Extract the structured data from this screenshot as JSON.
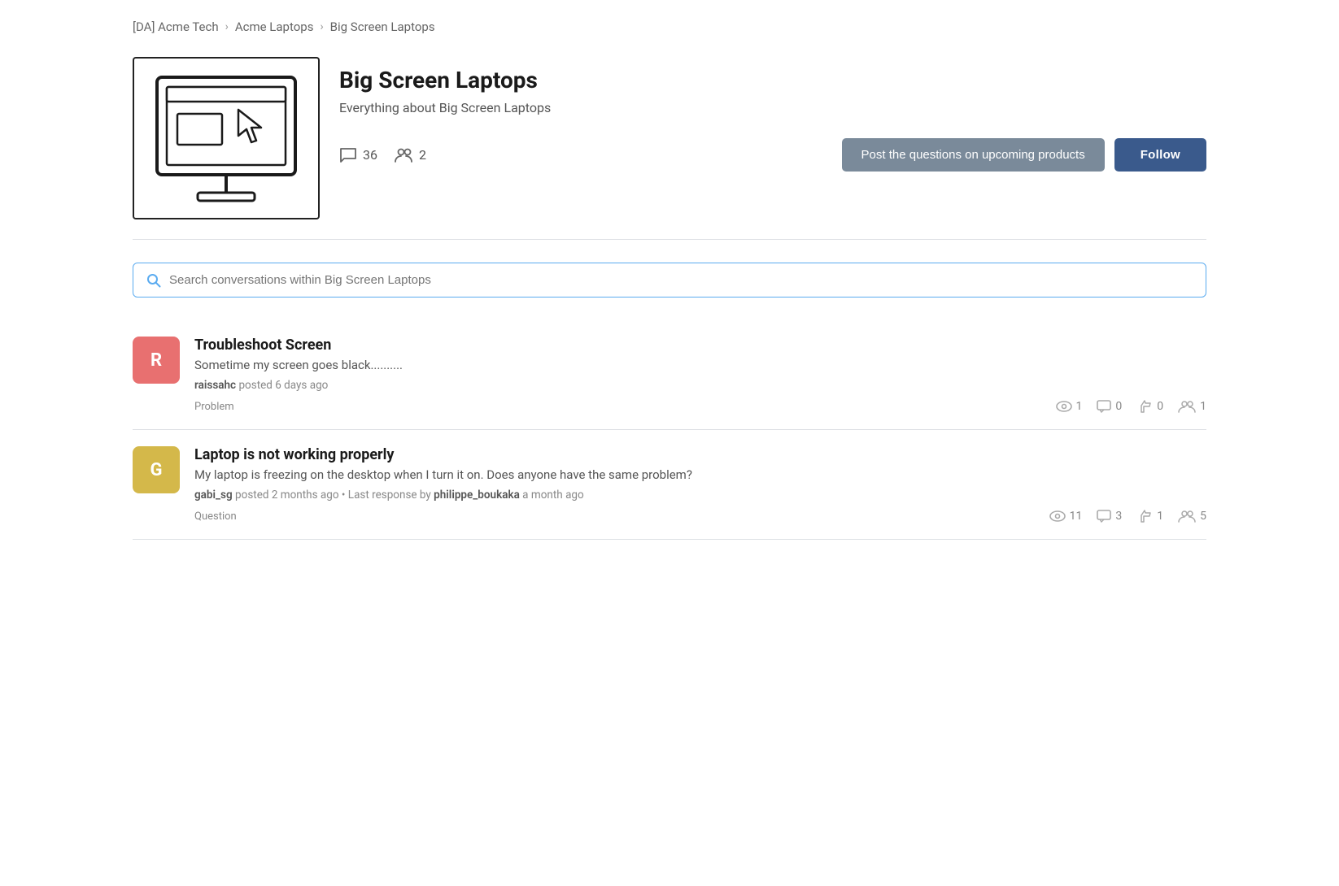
{
  "breadcrumb": {
    "items": [
      {
        "label": "[DA] Acme Tech"
      },
      {
        "label": "Acme Laptops"
      },
      {
        "label": "Big Screen Laptops"
      }
    ]
  },
  "header": {
    "title": "Big Screen Laptops",
    "subtitle": "Everything about Big Screen Laptops",
    "stats": {
      "conversations": "36",
      "members": "2"
    },
    "buttons": {
      "post_label": "Post the questions on upcoming products",
      "follow_label": "Follow"
    }
  },
  "search": {
    "placeholder": "Search conversations within Big Screen Laptops"
  },
  "posts": [
    {
      "id": 1,
      "avatar_letter": "R",
      "avatar_color": "red",
      "title": "Troubleshoot Screen",
      "excerpt": "Sometime my screen goes black..........",
      "author": "raissahc",
      "time": "6 days ago",
      "last_response": null,
      "tag": "Problem",
      "stats": {
        "views": "1",
        "comments": "0",
        "likes": "0",
        "followers": "1"
      }
    },
    {
      "id": 2,
      "avatar_letter": "G",
      "avatar_color": "yellow",
      "title": "Laptop is not working properly",
      "excerpt": "My laptop is freezing on the desktop when I turn it on. Does anyone have the same problem?",
      "author": "gabi_sg",
      "time": "2 months ago",
      "last_response_by": "philippe_boukaka",
      "last_response_time": "a month ago",
      "tag": "Question",
      "stats": {
        "views": "11",
        "comments": "3",
        "likes": "1",
        "followers": "5"
      }
    }
  ]
}
